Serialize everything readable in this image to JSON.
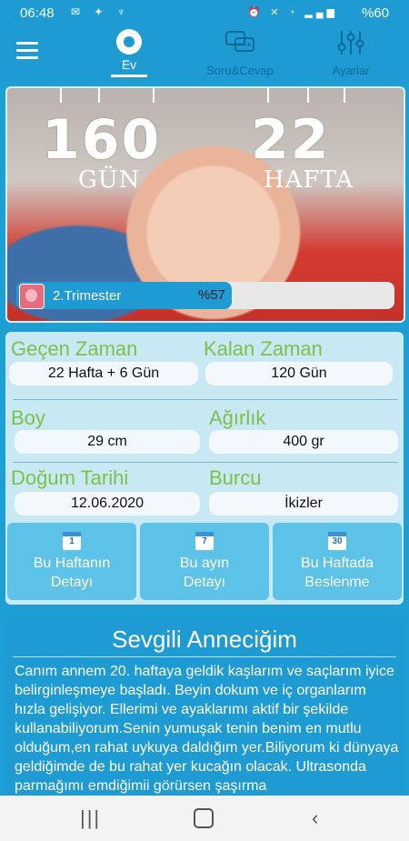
{
  "status": {
    "time": "06:48",
    "battery": "%60"
  },
  "nav": {
    "home_label": "Ev",
    "qa_label": "Soru&Cevap",
    "settings_label": "Ayarlar"
  },
  "hero": {
    "days_value": "160",
    "days_unit": "GÜN",
    "weeks_value": "22",
    "weeks_unit": "HAFTA",
    "trimester": "2.Trimester",
    "percent": "%57",
    "progress_fraction": 0.57
  },
  "info": {
    "elapsed_label": "Geçen Zaman",
    "elapsed_value": "22 Hafta + 6 Gün",
    "remaining_label": "Kalan Zaman",
    "remaining_value": "120 Gün",
    "height_label": "Boy",
    "height_value": "29 cm",
    "weight_label": "Ağırlık",
    "weight_value": "400 gr",
    "due_label": "Doğum Tarihi",
    "due_value": "12.06.2020",
    "sign_label": "Burcu",
    "sign_value": "İkizler"
  },
  "buttons": [
    {
      "day": "1",
      "line1": "Bu Haftanın",
      "line2": "Detayı"
    },
    {
      "day": "7",
      "line1": "Bu ayın",
      "line2": "Detayı"
    },
    {
      "day": "30",
      "line1": "Bu Haftada",
      "line2": "Beslenme"
    }
  ],
  "letter": {
    "title": "Sevgili Anneciğim",
    "body": "Canım annem 20. haftaya geldik kaşlarım ve saçlarım iyice belirginleşmeye başladı. Beyin dokum ve iç organlarım hızla gelişiyor. Ellerimi ve ayaklarımı aktif bir şekilde kullanabiliyorum.Senin yumuşak tenin benim en mutlu olduğum,en rahat uykuya daldığım yer.Biliyorum ki dünyaya geldiğimde de bu rahat yer kucağın olacak. Ultrasonda parmağımı emdiğimii görürsen şaşırma"
  }
}
